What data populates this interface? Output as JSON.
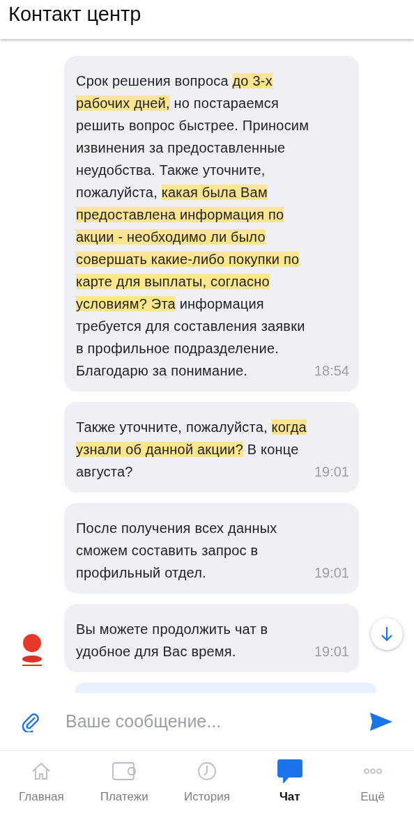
{
  "header": {
    "title": "Контакт центр"
  },
  "messages": [
    {
      "segments": [
        {
          "text": "Срок решения вопроса ",
          "highlighted": false
        },
        {
          "text": "до 3-х рабочих дней,",
          "highlighted": true
        },
        {
          "text": " но постараемся решить вопрос быстрее. Приносим извинения за предоставленные неудобства. Также уточните, пожалуйста, ",
          "highlighted": false
        },
        {
          "text": "какая была Вам предоставлена информация по акции - необходимо ли было совершать какие-либо покупки по карте для выплаты, согласно условиям? Эта",
          "highlighted": true
        },
        {
          "text": " информация требуется для составления заявки в профильное подразделение. Благодарю за понимание.",
          "highlighted": false
        }
      ],
      "time": "18:54",
      "avatar": false
    },
    {
      "segments": [
        {
          "text": "Также уточните, пожалуйста, ",
          "highlighted": false
        },
        {
          "text": "когда узнали об данной акции?",
          "highlighted": true
        },
        {
          "text": " В конце августа?",
          "highlighted": false
        }
      ],
      "time": "19:01",
      "avatar": false
    },
    {
      "segments": [
        {
          "text": "После получения всех данных сможем составить запрос в профильный отдел.",
          "highlighted": false
        }
      ],
      "time": "19:01",
      "avatar": false
    },
    {
      "segments": [
        {
          "text": "Вы можете продолжить чат в удобное для Вас время.",
          "highlighted": false
        }
      ],
      "time": "19:01",
      "avatar": true
    }
  ],
  "composer": {
    "placeholder": "Ваше сообщение..."
  },
  "nav": [
    {
      "label": "Главная",
      "kind": "home",
      "selected": false
    },
    {
      "label": "Платежи",
      "kind": "wallet",
      "selected": false
    },
    {
      "label": "История",
      "kind": "clock",
      "selected": false
    },
    {
      "label": "Чат",
      "kind": "chat",
      "selected": true
    },
    {
      "label": "Ещё",
      "kind": "more",
      "selected": false
    }
  ]
}
